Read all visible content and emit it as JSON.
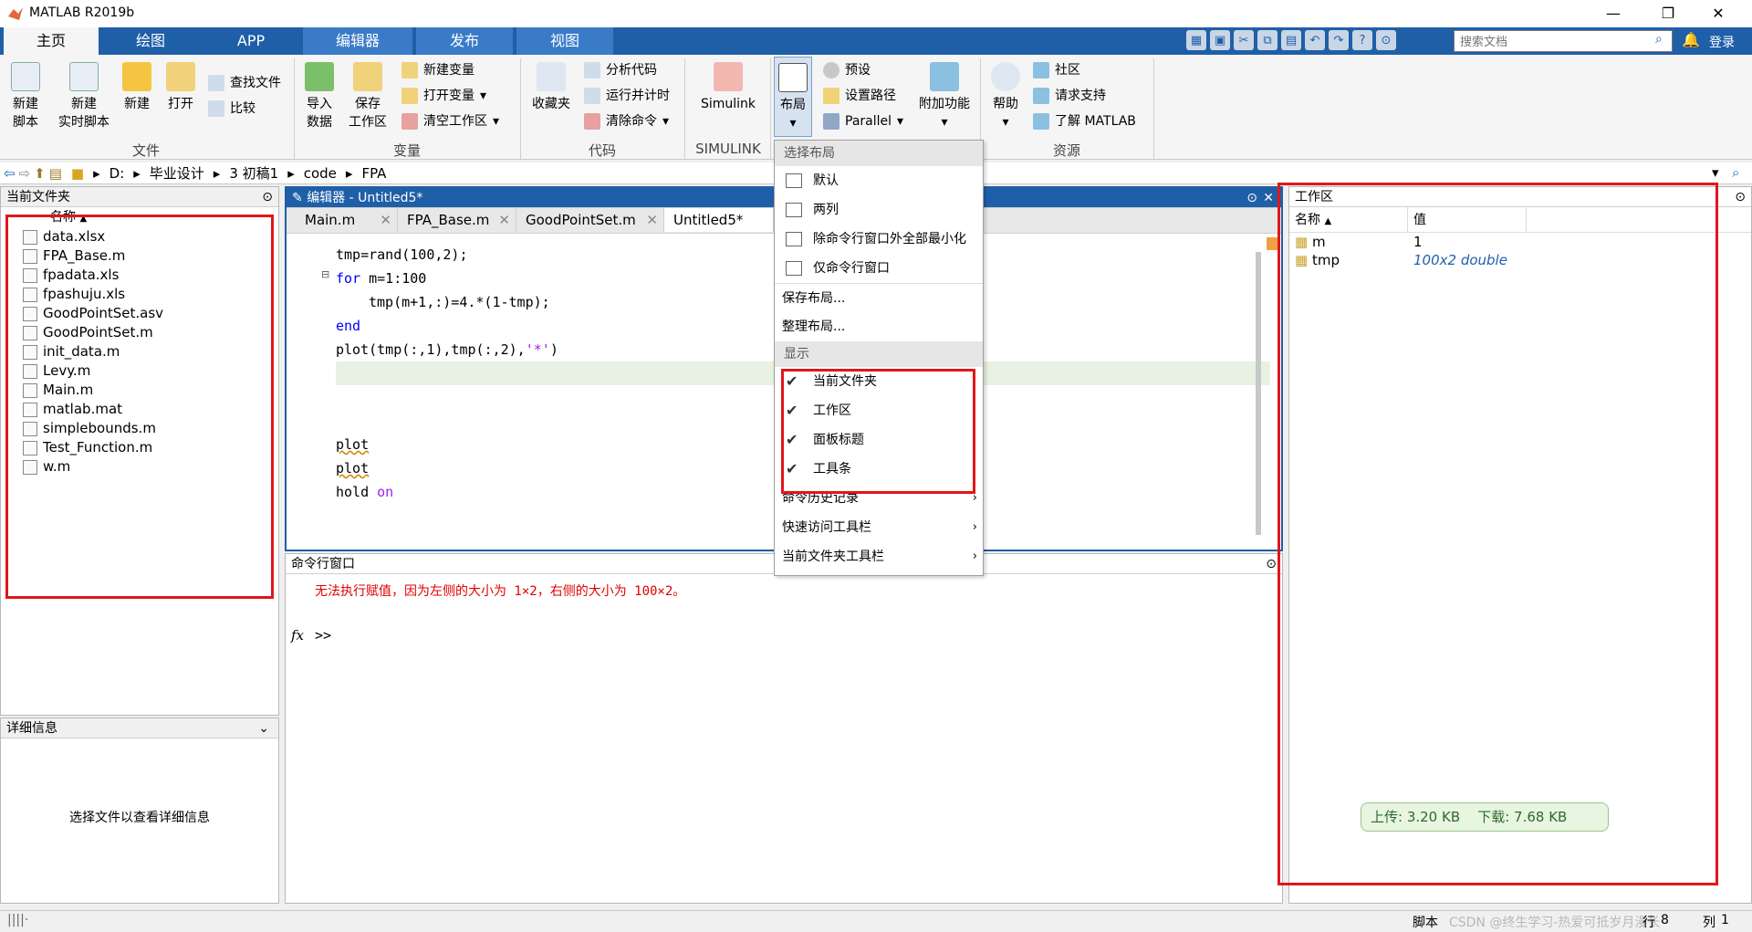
{
  "window": {
    "title": "MATLAB R2019b"
  },
  "tabs": [
    "主页",
    "绘图",
    "APP",
    "编辑器",
    "发布",
    "视图"
  ],
  "search": {
    "placeholder": "搜索文档"
  },
  "login_label": "登录",
  "ribbon": {
    "file_group": {
      "label": "文件",
      "new_script": "新建\n脚本",
      "new_live": "新建\n实时脚本",
      "new": "新建",
      "open": "打开",
      "find_files": "查找文件",
      "compare": "比较"
    },
    "var_group": {
      "label": "变量",
      "import": "导入\n数据",
      "save_ws": "保存\n工作区",
      "new_var": "新建变量",
      "open_var": "打开变量",
      "clear_ws": "清空工作区"
    },
    "code_group": {
      "label": "代码",
      "favorites": "收藏夹",
      "analyze": "分析代码",
      "run_time": "运行并计时",
      "clear_cmd": "清除命令"
    },
    "simulink_group": {
      "label": "SIMULINK",
      "simulink": "Simulink"
    },
    "env_group": {
      "layout": "布局",
      "prefs": "预设",
      "set_path": "设置路径",
      "parallel": "Parallel",
      "addons": "附加功能"
    },
    "res_group": {
      "label": "资源",
      "help": "帮助",
      "community": "社区",
      "request_support": "请求支持",
      "learn": "了解 MATLAB"
    }
  },
  "address": {
    "drive": "D:",
    "crumbs": [
      "毕业设计",
      "3 初稿1",
      "code",
      "FPA"
    ]
  },
  "current_folder": {
    "title": "当前文件夹",
    "name_col": "名称",
    "files": [
      "data.xlsx",
      "FPA_Base.m",
      "fpadata.xls",
      "fpashuju.xls",
      "GoodPointSet.asv",
      "GoodPointSet.m",
      "init_data.m",
      "Levy.m",
      "Main.m",
      "matlab.mat",
      "simplebounds.m",
      "Test_Function.m",
      "w.m"
    ]
  },
  "details": {
    "title": "详细信息",
    "message": "选择文件以查看详细信息"
  },
  "editor": {
    "title": "编辑器 - Untitled5*",
    "tabs": [
      "Main.m",
      "FPA_Base.m",
      "GoodPointSet.m",
      "Untitled5*"
    ],
    "lines": [
      "tmp=rand(100,2);",
      "for",
      " m=1:100",
      "tmp(m+1,:)=4.*(1-tmp);",
      "end",
      "plot(tmp(:,1),tmp(:,2),",
      "'*'",
      ")",
      "plot",
      "plot",
      "hold",
      "on"
    ]
  },
  "command_window": {
    "title": "命令行窗口",
    "error": "无法执行赋值，因为左侧的大小为 1×2，右侧的大小为 100×2。",
    "prompt": ">>"
  },
  "workspace": {
    "title": "工作区",
    "columns": [
      "名称",
      "值"
    ],
    "vars": [
      {
        "name": "m",
        "value": "1"
      },
      {
        "name": "tmp",
        "value": "100x2 double"
      }
    ],
    "net": {
      "up": "上传: 3.20 KB",
      "down": "下载: 7.68 KB"
    }
  },
  "layout_menu": {
    "header1": "选择布局",
    "layouts": [
      "默认",
      "两列",
      "除命令行窗口外全部最小化",
      "仅命令行窗口"
    ],
    "save": "保存布局...",
    "organize": "整理布局...",
    "header2": "显示",
    "show": [
      "当前文件夹",
      "工作区",
      "面板标题",
      "工具条"
    ],
    "more": [
      "命令历史记录",
      "快速访问工具栏",
      "当前文件夹工具栏"
    ]
  },
  "status": {
    "mode": "脚本",
    "row_label": "行",
    "row": "8",
    "col_label": "列",
    "col": "1",
    "watermark": "CSDN @终生学习-热爱可抵岁月漫长"
  },
  "colors": {
    "tab_blue": "#1f5fa8",
    "highlight_red": "#e0161b",
    "error_red": "#e00000"
  }
}
